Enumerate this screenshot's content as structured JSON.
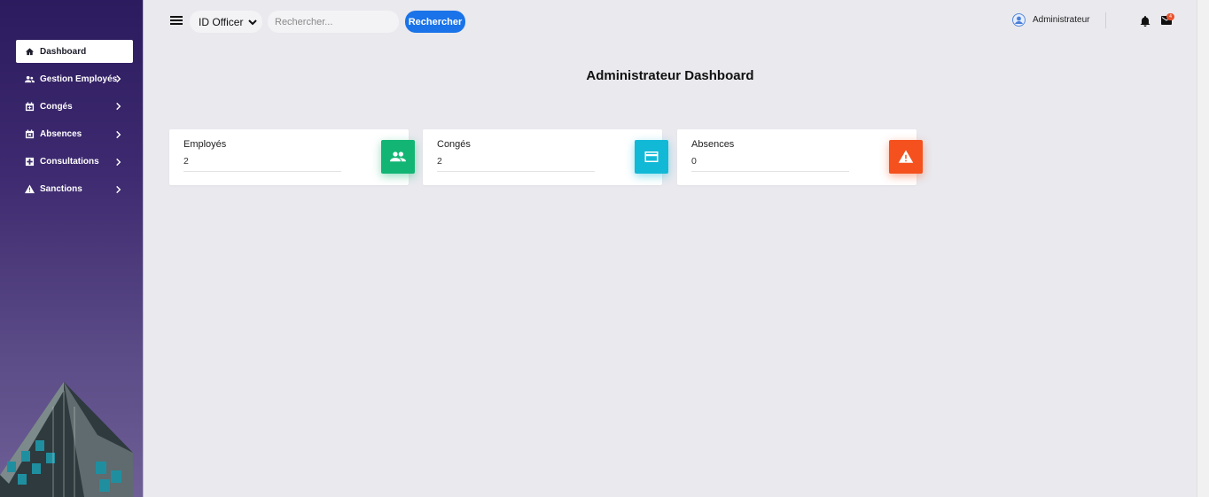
{
  "sidebar": {
    "items": [
      {
        "label": "Dashboard",
        "icon": "home-icon",
        "active": true
      },
      {
        "label": "Gestion Employés",
        "icon": "people-icon",
        "active": false
      },
      {
        "label": "Congés",
        "icon": "calendar-plus-icon",
        "active": false
      },
      {
        "label": "Absences",
        "icon": "calendar-x-icon",
        "active": false
      },
      {
        "label": "Consultations",
        "icon": "medical-cross-icon",
        "active": false
      },
      {
        "label": "Sanctions",
        "icon": "warning-icon",
        "active": false
      }
    ]
  },
  "header": {
    "select_value": "ID Officer",
    "search_placeholder": "Rechercher...",
    "search_button": "Rechercher",
    "user_name": "Administrateur",
    "mail_badge": "4"
  },
  "main": {
    "title": "Administrateur Dashboard",
    "cards": [
      {
        "label": "Employés",
        "value": "2",
        "color": "#13b574",
        "icon": "people-icon"
      },
      {
        "label": "Congés",
        "value": "2",
        "color": "#12b9d7",
        "icon": "card-icon"
      },
      {
        "label": "Absences",
        "value": "0",
        "color": "#f4511e",
        "icon": "warning-icon"
      }
    ]
  },
  "colors": {
    "accent": "#1a73e8",
    "sidebar_top": "#2c1b5e",
    "background": "#e9e9ee"
  }
}
